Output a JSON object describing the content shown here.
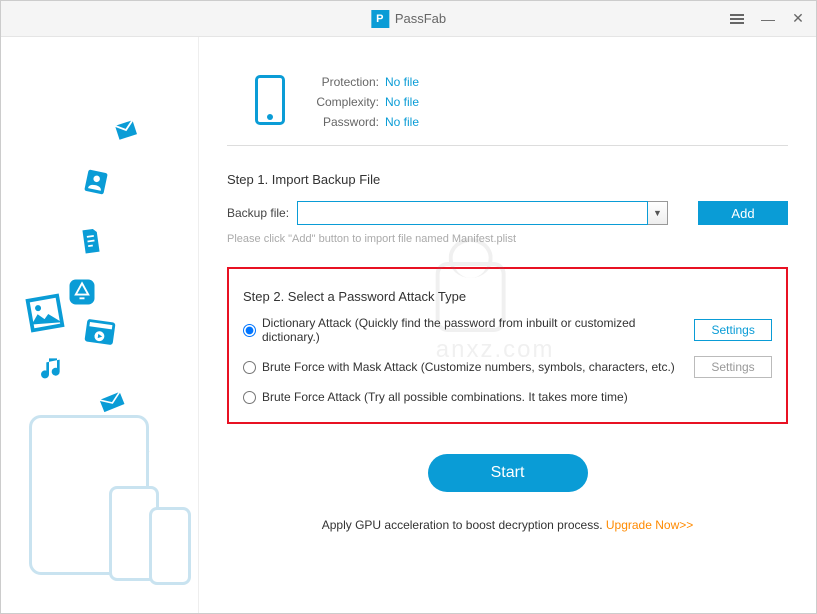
{
  "app": {
    "name": "PassFab"
  },
  "info": {
    "protection_label": "Protection:",
    "protection_value": "No file",
    "complexity_label": "Complexity:",
    "complexity_value": "No file",
    "password_label": "Password:",
    "password_value": "No file"
  },
  "step1": {
    "title": "Step 1. Import Backup File",
    "backup_label": "Backup file:",
    "backup_value": "",
    "add_button": "Add",
    "hint": "Please click \"Add\" button to import file named Manifest.plist"
  },
  "step2": {
    "title": "Step 2. Select a Password Attack Type",
    "options": [
      {
        "label": "Dictionary Attack (Quickly find the password from inbuilt or customized dictionary.)",
        "settings": "Settings",
        "settings_enabled": true,
        "checked": true
      },
      {
        "label": "Brute Force with Mask Attack (Customize numbers, symbols, characters, etc.)",
        "settings": "Settings",
        "settings_enabled": false,
        "checked": false
      },
      {
        "label": "Brute Force Attack (Try all possible combinations. It takes more time)",
        "settings": null,
        "checked": false
      }
    ]
  },
  "start_button": "Start",
  "footer": {
    "text": "Apply GPU acceleration to boost decryption process.  ",
    "upgrade": "Upgrade Now>>"
  },
  "colors": {
    "accent": "#0a9cd6",
    "highlight_border": "#e81123",
    "upgrade": "#ff8a00"
  }
}
